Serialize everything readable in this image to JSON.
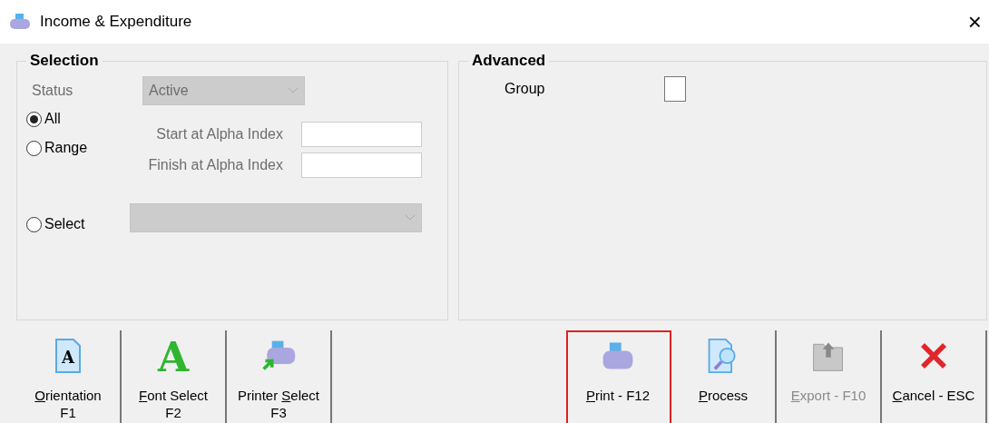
{
  "window": {
    "title": "Income & Expenditure",
    "close": "×"
  },
  "selection": {
    "title": "Selection",
    "status_label": "Status",
    "status_value": "Active",
    "status_disabled": true,
    "radios": [
      {
        "label": "All",
        "selected": true
      },
      {
        "label": "Range",
        "selected": false
      },
      {
        "label": "Select",
        "selected": false
      }
    ],
    "start_label": "Start at Alpha Index",
    "finish_label": "Finish at Alpha Index",
    "select_disabled": true
  },
  "advanced": {
    "title": "Advanced",
    "group_label": "Group",
    "group_checked": false
  },
  "left_buttons": [
    {
      "kind": "orientation",
      "glyph": "A",
      "key": "O",
      "post": "rientation",
      "line2": "F1",
      "disabled": false,
      "focused": false
    },
    {
      "kind": "font",
      "glyph": "A",
      "key": "F",
      "post": "ont Select",
      "line2": "F2",
      "disabled": false,
      "focused": false
    },
    {
      "kind": "printer-select",
      "pre": "Printer ",
      "key": "S",
      "post": "elect",
      "line2": "F3",
      "disabled": false,
      "focused": false
    }
  ],
  "right_buttons": [
    {
      "kind": "print",
      "key": "P",
      "post": "rint - F12",
      "disabled": false,
      "focused": true
    },
    {
      "kind": "process",
      "key": "P",
      "post": "rocess",
      "disabled": false,
      "focused": false
    },
    {
      "kind": "export",
      "key": "E",
      "post": "xport - F10",
      "disabled": true,
      "focused": false
    },
    {
      "kind": "cancel",
      "key": "C",
      "post": "ancel - ESC",
      "disabled": false,
      "focused": false
    }
  ]
}
